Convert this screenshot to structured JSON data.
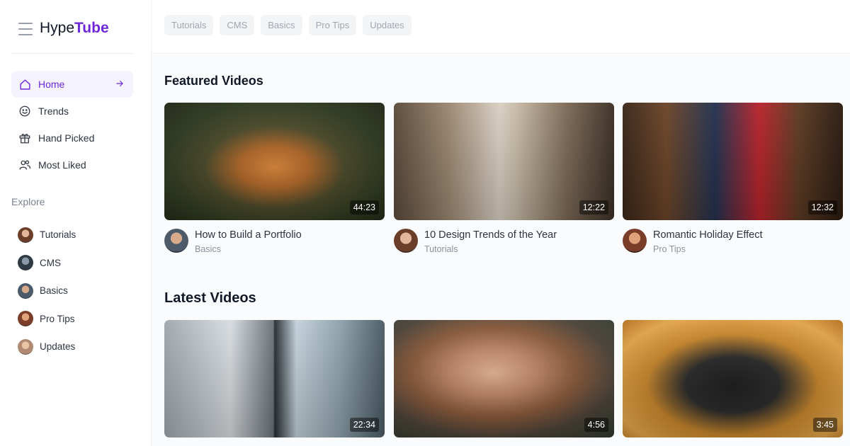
{
  "brand": {
    "name_prefix": "Hype",
    "name_accent": "Tube"
  },
  "nav": {
    "items": [
      {
        "label": "Home",
        "icon": "home-icon",
        "active": true
      },
      {
        "label": "Trends",
        "icon": "smiley-icon"
      },
      {
        "label": "Hand Picked",
        "icon": "gift-icon"
      },
      {
        "label": "Most Liked",
        "icon": "users-icon"
      }
    ]
  },
  "explore": {
    "title": "Explore",
    "channels": [
      {
        "label": "Tutorials"
      },
      {
        "label": "CMS"
      },
      {
        "label": "Basics"
      },
      {
        "label": "Pro Tips"
      },
      {
        "label": "Updates"
      }
    ]
  },
  "chips": [
    "Tutorials",
    "CMS",
    "Basics",
    "Pro Tips",
    "Updates"
  ],
  "featured": {
    "title": "Featured Videos",
    "videos": [
      {
        "title": "How to Build a Portfolio",
        "category": "Basics",
        "duration": "44:23"
      },
      {
        "title": "10 Design Trends of the Year",
        "category": "Tutorials",
        "duration": "12:22"
      },
      {
        "title": "Romantic Holiday Effect",
        "category": "Pro Tips",
        "duration": "12:32"
      }
    ]
  },
  "latest": {
    "title": "Latest Videos",
    "videos": [
      {
        "duration": "22:34"
      },
      {
        "duration": "4:56"
      },
      {
        "duration": "3:45"
      }
    ]
  },
  "colors": {
    "accent": "#6d28d9",
    "active_bg": "#f5f3fd",
    "chip_bg": "#f3f4f6"
  }
}
